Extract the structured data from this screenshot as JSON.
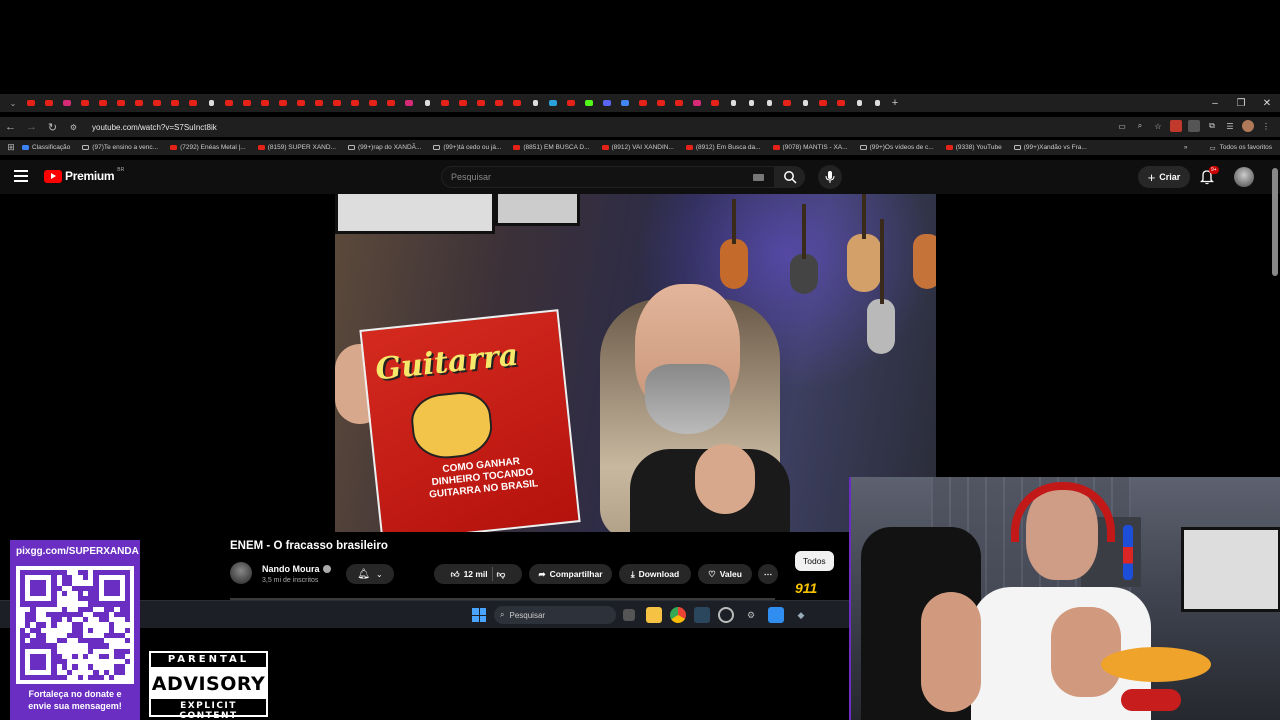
{
  "browser": {
    "url": "youtube.com/watch?v=S7SuInct8ik",
    "tab_icons": [
      "yt",
      "yt",
      "instagram",
      "yt",
      "yt",
      "yt",
      "yt",
      "yt",
      "yt",
      "yt",
      "tiktok",
      "yt",
      "yt",
      "yt",
      "yt",
      "yt",
      "yt",
      "yt",
      "yt",
      "yt",
      "yt",
      "instagram",
      "tiktok",
      "yt",
      "yt",
      "yt",
      "yt",
      "yt",
      "tiktok",
      "telegram",
      "yt",
      "kick",
      "discord",
      "google",
      "yt",
      "yt",
      "yt",
      "instagram",
      "yt",
      "tiktok",
      "tiktok",
      "tiktok",
      "yt",
      "tiktok",
      "yt",
      "yt",
      "tiktok",
      "tiktok"
    ],
    "bookmarks": [
      {
        "icon": "chrome",
        "label": "Classificação"
      },
      {
        "icon": "tiktok",
        "label": "(97)Te ensino a venc..."
      },
      {
        "icon": "yt",
        "label": "(7292) Enéas Metal |..."
      },
      {
        "icon": "yt",
        "label": "(8159) SUPER XAND..."
      },
      {
        "icon": "tiktok",
        "label": "(99+)rap do XANDÃ..."
      },
      {
        "icon": "tiktok",
        "label": "(99+)tá cedo ou já..."
      },
      {
        "icon": "yt",
        "label": "(8851) EM BUSCA D..."
      },
      {
        "icon": "yt",
        "label": "(8912) VAI XANDIN..."
      },
      {
        "icon": "yt",
        "label": "(8912) Em Busca da..."
      },
      {
        "icon": "yt",
        "label": "(9078) MANTIS - XA..."
      },
      {
        "icon": "tiktok",
        "label": "(99+)Os vídeos de c..."
      },
      {
        "icon": "yt",
        "label": "(9338) YouTube"
      },
      {
        "icon": "tiktok",
        "label": "(99+)Xandão vs Fra..."
      }
    ],
    "all_bookmarks_label": "Todos os favoritos"
  },
  "youtube": {
    "logo_text": "Premium",
    "country_code": "BR",
    "search_placeholder": "Pesquisar",
    "create_label": "Criar",
    "notifications_badge": "9+",
    "video": {
      "title": "ENEM - O fracasso brasileiro",
      "channel": "Nando Moura",
      "subscribers": "3,5 mi de inscritos",
      "likes": "12 mil",
      "share_label": "Compartilhar",
      "download_label": "Download",
      "thanks_label": "Valeu",
      "magazine_title": "Guitarra",
      "magazine_text": "COMO GANHAR DINHEIRO TOCANDO GUITARRA NO BRASIL"
    },
    "chip_todos": "Todos"
  },
  "taskbar": {
    "search_placeholder": "Pesquisar"
  },
  "overlay": {
    "qr_url": "pixgg.com/SUPERXANDA",
    "qr_caption_line1": "Fortaleça no donate e",
    "qr_caption_line2": "envie sua mensagem!",
    "advisory_top": "PARENTAL",
    "advisory_mid": "ADVISORY",
    "advisory_bot": "EXPLICIT CONTENT",
    "accent": "#6a2ec2"
  }
}
